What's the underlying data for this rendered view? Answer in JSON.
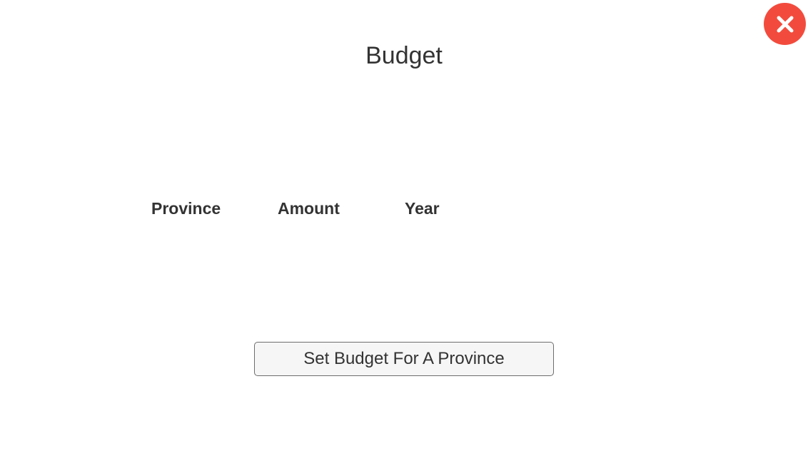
{
  "header": {
    "title": "Budget",
    "close_icon": "close-icon"
  },
  "table": {
    "columns": [
      "Province",
      "Amount",
      "Year"
    ],
    "rows": []
  },
  "actions": {
    "set_budget_label": "Set Budget For A Province"
  },
  "colors": {
    "close_button": "#f24b3d",
    "text": "#333333",
    "button_background": "#f6f6f6",
    "button_border": "#6d6d6d"
  }
}
